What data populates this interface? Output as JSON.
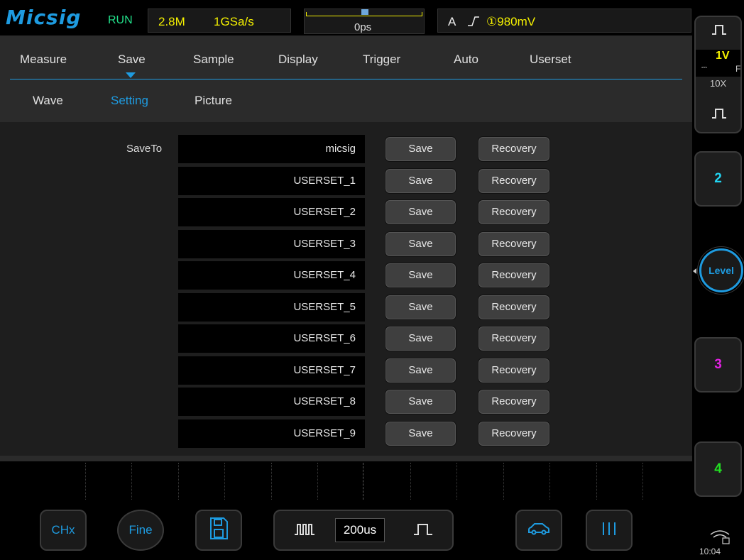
{
  "status": {
    "brand": "Micsig",
    "run_state": "RUN",
    "memory_depth": "2.8M",
    "sample_rate": "1GSa/s",
    "trigger_delay": "0ps",
    "trigger_mode": "A",
    "trigger_edge": "∕",
    "trigger_level": "①980mV"
  },
  "main_menu": {
    "items": [
      "Measure",
      "Save",
      "Sample",
      "Display",
      "Trigger",
      "Auto",
      "Userset"
    ],
    "active": "Save"
  },
  "sub_menu": {
    "items": [
      "Wave",
      "Setting",
      "Picture"
    ],
    "active": "Setting"
  },
  "save_panel": {
    "label": "SaveTo",
    "save_label": "Save",
    "recovery_label": "Recovery",
    "slots": [
      "micsig",
      "USERSET_1",
      "USERSET_2",
      "USERSET_3",
      "USERSET_4",
      "USERSET_5",
      "USERSET_6",
      "USERSET_7",
      "USERSET_8",
      "USERSET_9"
    ]
  },
  "channels": {
    "ch1": {
      "scale": "1V",
      "probe": "10X",
      "coupling": "F",
      "color": "#f4f000"
    },
    "ch2": {
      "label": "2",
      "color": "#22d3f0"
    },
    "ch3": {
      "label": "3",
      "color": "#e020e0"
    },
    "ch4": {
      "label": "4",
      "color": "#22e022"
    },
    "level_label": "Level"
  },
  "toolbar": {
    "chx_label": "CHx",
    "fine_label": "Fine",
    "timebase": "200us",
    "icons": [
      "save-disk-icon",
      "timebase-decrease-icon",
      "timebase-increase-icon",
      "car-icon",
      "cursor-icon"
    ]
  },
  "system": {
    "time": "10:04"
  },
  "colors": {
    "accent": "#1e9be0",
    "run": "#22e08a",
    "ch1": "#f4f000"
  }
}
